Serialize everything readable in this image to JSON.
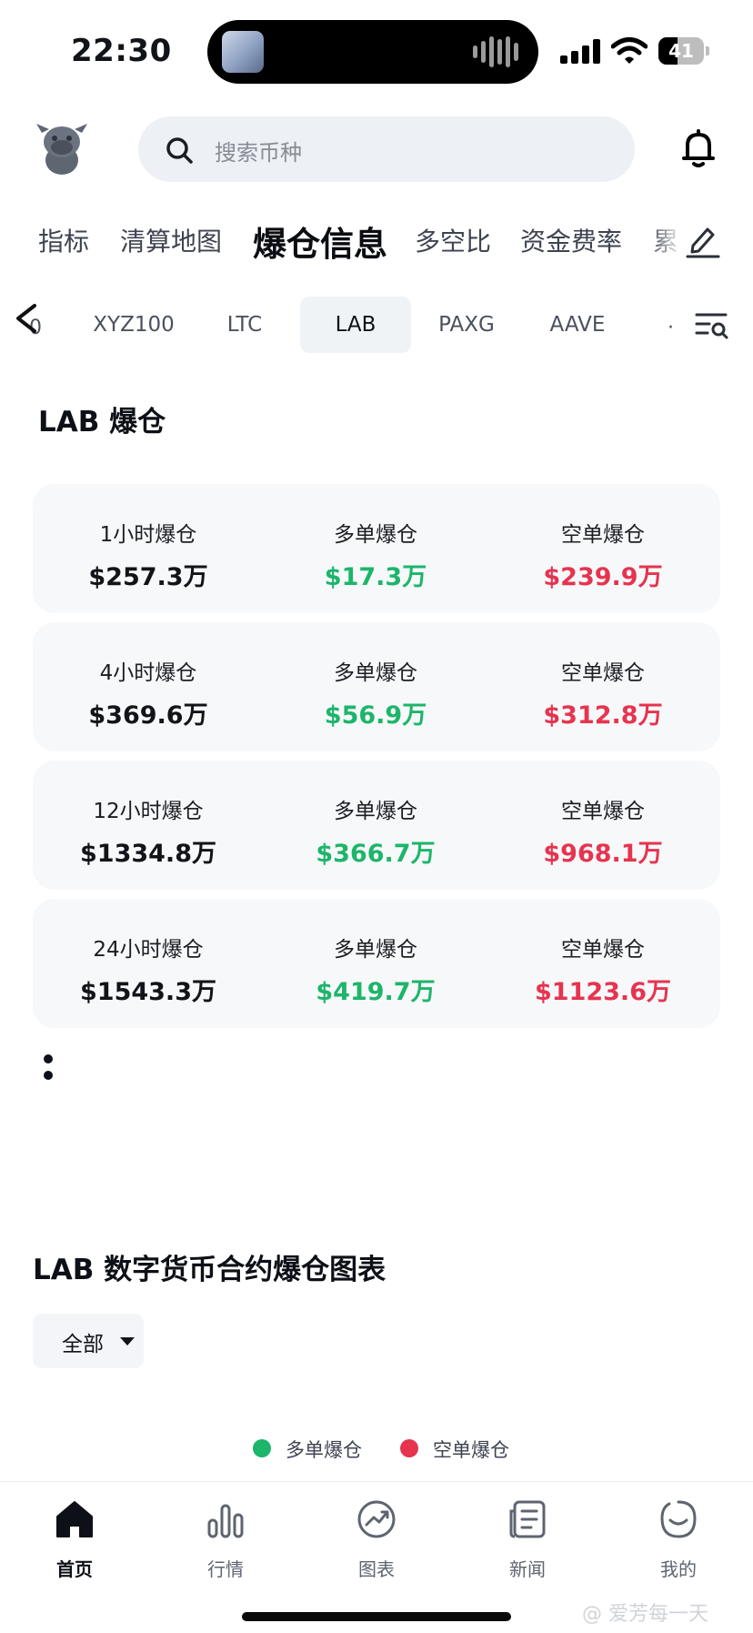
{
  "status_bar": {
    "time": "22:30",
    "battery_level": "41"
  },
  "search": {
    "placeholder": "搜索币种"
  },
  "category_tabs": [
    {
      "label": "指标",
      "active": false
    },
    {
      "label": "清算地图",
      "active": false
    },
    {
      "label": "爆仓信息",
      "active": true
    },
    {
      "label": "多空比",
      "active": false
    },
    {
      "label": "资金费率",
      "active": false
    },
    {
      "label": "累",
      "active": false
    }
  ],
  "coin_tabs": {
    "partial_left": "0",
    "items": [
      {
        "label": "XYZ100",
        "active": false
      },
      {
        "label": "LTC",
        "active": false
      },
      {
        "label": "LAB",
        "active": true
      },
      {
        "label": "PAXG",
        "active": false
      },
      {
        "label": "AAVE",
        "active": false
      }
    ],
    "partial_right": "·"
  },
  "section": {
    "title": "LAB 爆仓"
  },
  "stats": [
    {
      "period": "1小时爆仓",
      "total": "$257.3万",
      "long_label": "多单爆仓",
      "long": "$17.3万",
      "short_label": "空单爆仓",
      "short": "$239.9万"
    },
    {
      "period": "4小时爆仓",
      "total": "$369.6万",
      "long_label": "多单爆仓",
      "long": "$56.9万",
      "short_label": "空单爆仓",
      "short": "$312.8万"
    },
    {
      "period": "12小时爆仓",
      "total": "$1334.8万",
      "long_label": "多单爆仓",
      "long": "$366.7万",
      "short_label": "空单爆仓",
      "short": "$968.1万"
    },
    {
      "period": "24小时爆仓",
      "total": "$1543.3万",
      "long_label": "多单爆仓",
      "long": "$419.7万",
      "short_label": "空单爆仓",
      "short": "$1123.6万"
    }
  ],
  "chart": {
    "title": "LAB 数字货币合约爆仓图表",
    "range_selected": "全部",
    "legend": [
      {
        "label": "多单爆仓",
        "color": "#1db56a"
      },
      {
        "label": "空单爆仓",
        "color": "#e6344f"
      }
    ]
  },
  "nav": [
    {
      "label": "首页",
      "icon": "home-icon",
      "active": true
    },
    {
      "label": "行情",
      "icon": "market-bars-icon",
      "active": false
    },
    {
      "label": "图表",
      "icon": "chart-trend-icon",
      "active": false
    },
    {
      "label": "新闻",
      "icon": "news-icon",
      "active": false
    },
    {
      "label": "我的",
      "icon": "profile-icon",
      "active": false
    }
  ],
  "watermark": "@ 爱芳每一天",
  "colors": {
    "long": "#1db56a",
    "short": "#e6344f",
    "card_bg": "#f6f8fa",
    "search_bg": "#edf0f4"
  }
}
